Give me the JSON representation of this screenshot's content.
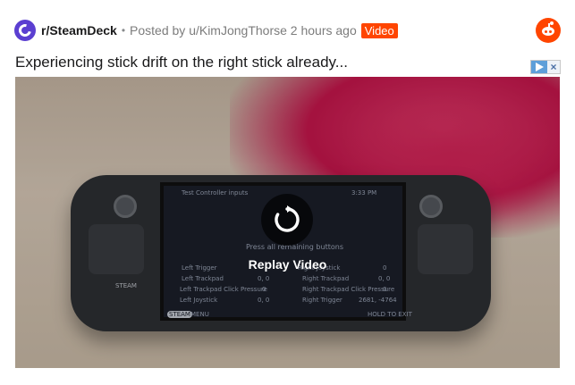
{
  "post": {
    "subreddit": "r/SteamDeck",
    "separator": "•",
    "posted_by_prefix": "Posted by",
    "author": "u/KimJongThorse",
    "time": "2 hours ago",
    "badge": "Video",
    "title": "Experiencing stick drift on the right stick already..."
  },
  "video": {
    "replay_label": "Replay Video",
    "screen": {
      "header": "Test Controller inputs",
      "time": "3:33 PM",
      "prompt": "Press all remaining buttons",
      "rows": [
        {
          "left_label": "Left Trigger",
          "left_value": "0",
          "right_label": "Right Trigger",
          "right_value": "0"
        },
        {
          "left_label": "Left Trackpad",
          "left_value": "0, 0",
          "right_label": "Right Trackpad",
          "right_value": "0, 0"
        },
        {
          "left_label": "Left Trackpad Click Pressure",
          "left_value": "0",
          "right_label": "Right Trackpad Click Pressure",
          "right_value": "0"
        },
        {
          "left_label": "Left Joystick",
          "left_value": "0, 0",
          "right_label": "Right Joystick",
          "right_value": "2681, -4764"
        }
      ],
      "footer_left_key": "STEAM",
      "footer_left": "MENU",
      "footer_right": "HOLD TO EXIT"
    },
    "device_label": "STEAM"
  },
  "colors": {
    "subreddit_icon": "#5b3fd1",
    "badge": "#ff4500",
    "reddit_brand": "#ff4500"
  },
  "icons": {
    "subreddit": "steamdeck-logo-icon",
    "brand": "reddit-logo-icon",
    "replay": "replay-icon",
    "ad_play": "ad-choices-icon",
    "ad_close": "close-icon"
  }
}
